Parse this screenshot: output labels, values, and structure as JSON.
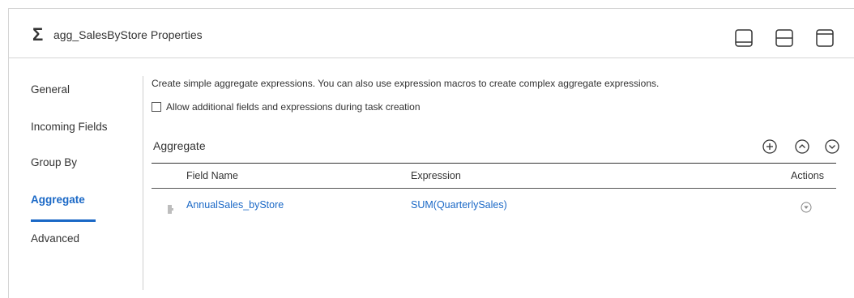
{
  "header": {
    "sigma_glyph": "Σ",
    "title": "agg_SalesByStore Properties",
    "layout_buttons": [
      "layout-bottom-panel-icon",
      "layout-split-icon",
      "layout-top-panel-icon"
    ]
  },
  "sidebar": {
    "items": [
      {
        "label": "General",
        "active": false
      },
      {
        "label": "Incoming Fields",
        "active": false
      },
      {
        "label": "Group By",
        "active": false
      },
      {
        "label": "Aggregate",
        "active": true
      },
      {
        "label": "Advanced",
        "active": false
      }
    ]
  },
  "content": {
    "description": "Create simple aggregate expressions. You can also use expression macros to create complex aggregate expressions.",
    "checkbox": {
      "label": "Allow additional fields and expressions during task creation",
      "checked": false
    },
    "section_title": "Aggregate",
    "section_icons": [
      "add-icon",
      "move-up-icon",
      "move-down-icon"
    ],
    "table": {
      "columns": [
        "Field Name",
        "Expression",
        "Actions"
      ],
      "rows": [
        {
          "field_name": "AnnualSales_byStore",
          "expression": "SUM(QuarterlySales)"
        }
      ]
    }
  },
  "colors": {
    "accent": "#1a68c6",
    "text": "#333333",
    "border": "#d6d6d6"
  }
}
